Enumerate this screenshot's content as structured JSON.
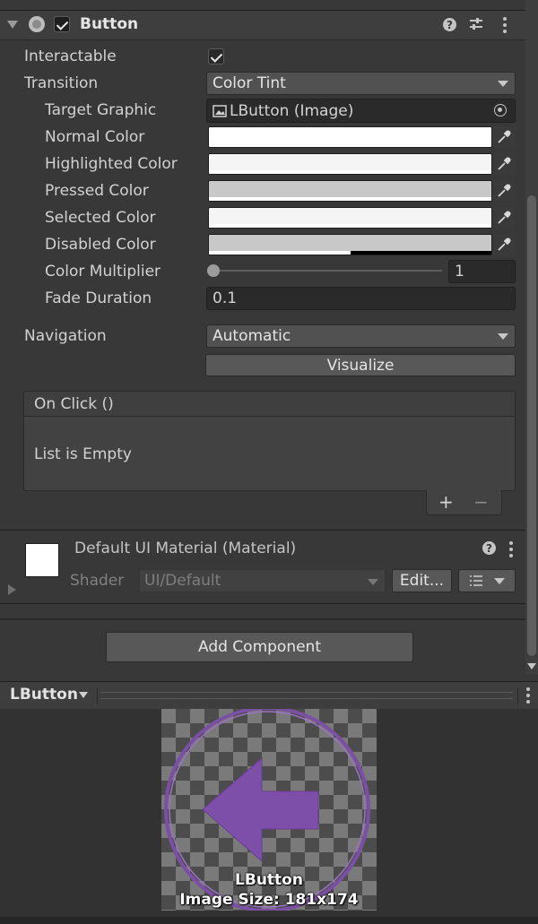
{
  "header": {
    "title": "Button",
    "enabled": true
  },
  "props": {
    "interactable": {
      "label": "Interactable",
      "checked": true
    },
    "transition": {
      "label": "Transition",
      "value": "Color Tint"
    },
    "target_graphic": {
      "label": "Target Graphic",
      "value": "LButton (Image)"
    },
    "normal_color": {
      "label": "Normal Color",
      "color": "#ffffff"
    },
    "highlighted_color": {
      "label": "Highlighted Color",
      "color": "#f5f5f5"
    },
    "pressed_color": {
      "label": "Pressed Color",
      "color": "#c8c8c8"
    },
    "selected_color": {
      "label": "Selected Color",
      "color": "#f5f5f5"
    },
    "disabled_color": {
      "label": "Disabled Color",
      "color": "#c8c8c8",
      "alpha": 0.5
    },
    "color_multiplier": {
      "label": "Color Multiplier",
      "value": "1",
      "slider_fraction": 0
    },
    "fade_duration": {
      "label": "Fade Duration",
      "value": "0.1"
    },
    "navigation": {
      "label": "Navigation",
      "value": "Automatic"
    },
    "visualize_label": "Visualize"
  },
  "on_click": {
    "title": "On Click ()",
    "empty_text": "List is Empty",
    "add": "+",
    "remove": "−"
  },
  "material": {
    "title": "Default UI Material (Material)",
    "shader_label": "Shader",
    "shader_value": "UI/Default",
    "edit_label": "Edit..."
  },
  "add_component_label": "Add Component",
  "preview": {
    "object_name": "LButton",
    "name_overlay": "LButton",
    "size_text": "Image Size: 181x174"
  },
  "colors": {
    "accent_purple": "#7b4fa3"
  }
}
